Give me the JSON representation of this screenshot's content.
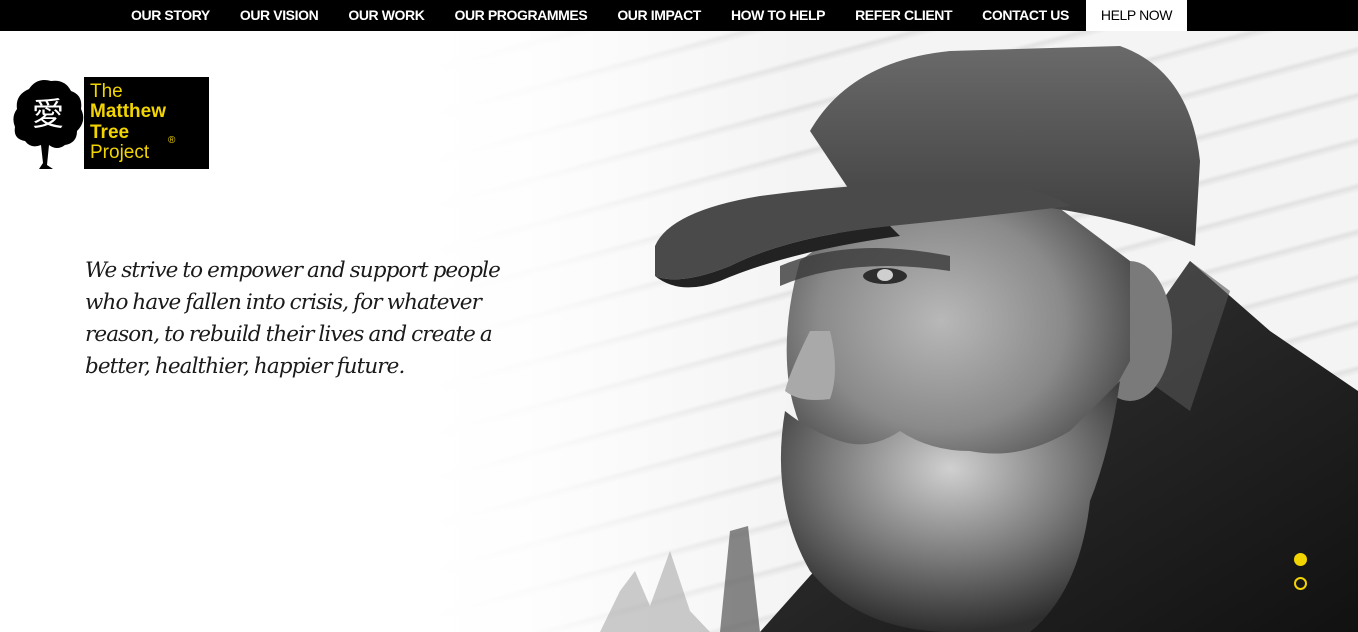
{
  "nav": {
    "items": [
      {
        "label": "OUR STORY"
      },
      {
        "label": "OUR VISION"
      },
      {
        "label": "OUR WORK"
      },
      {
        "label": "OUR PROGRAMMES"
      },
      {
        "label": "OUR IMPACT"
      },
      {
        "label": "HOW TO HELP"
      },
      {
        "label": "REFER CLIENT"
      },
      {
        "label": "CONTACT US"
      }
    ],
    "help_label": "HELP NOW"
  },
  "logo": {
    "glyph": "愛",
    "line1": "The",
    "line2": "Matthew",
    "line3": "Tree",
    "line4": "Project",
    "reg": "®",
    "icon": "tree-icon"
  },
  "hero": {
    "tagline_lines": [
      "We strive to empower and support people",
      "who have fallen into crisis, for whatever",
      "reason,  to rebuild their lives and create a",
      "better, healthier,  happier future."
    ],
    "image_subject": "bearded-man-in-cap-photo"
  },
  "slider": {
    "active_index": 0,
    "count": 2
  },
  "colors": {
    "brand_yellow": "#f2d400",
    "nav_bg": "#000000",
    "text": "#1a1a1a"
  }
}
